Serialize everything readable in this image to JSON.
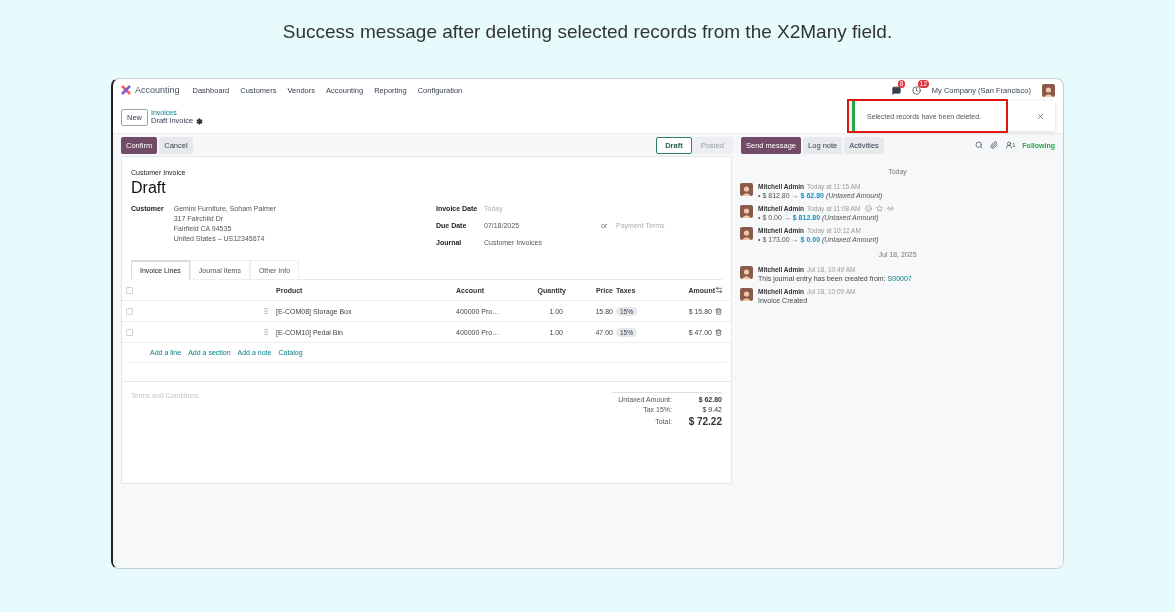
{
  "caption": "Success message after deleting selected records from the X2Many field.",
  "navbar": {
    "app": "Accounting",
    "menu": [
      "Dashboard",
      "Customers",
      "Vendors",
      "Accounting",
      "Reporting",
      "Configuration"
    ],
    "message_count": "8",
    "activity_count": "12",
    "company": "My Company (San Francisco)"
  },
  "breadcrumb": {
    "new_button": "New",
    "parent": "Invoices",
    "current": "Draft Invoice"
  },
  "notification": {
    "message": "Selected records have been deleted."
  },
  "actions": [
    {
      "label": "Confirm",
      "kind": "primary"
    },
    {
      "label": "Cancel",
      "kind": "secondary"
    }
  ],
  "statusbar": [
    {
      "label": "Draft",
      "selected": true
    },
    {
      "label": "Posted",
      "selected": false
    }
  ],
  "chatter_buttons": [
    {
      "label": "Send message",
      "kind": "primary"
    },
    {
      "label": "Log note",
      "kind": "secondary"
    },
    {
      "label": "Activities",
      "kind": "secondary"
    }
  ],
  "followers": {
    "count": "1",
    "following": "Following"
  },
  "form": {
    "type_label": "Customer Invoice",
    "title": "Draft",
    "customer": {
      "label": "Customer",
      "lines": [
        "Gemini Furniture, Soham Palmer",
        "317 Fairchild Dr",
        "Fairfield CA 94535",
        "United States – US12345674"
      ]
    },
    "fields": [
      {
        "label": "Invoice Date",
        "placeholder": "Today"
      },
      {
        "label": "Due Date",
        "value": "07/18/2025",
        "or": "or",
        "terms_placeholder": "Payment Terms"
      },
      {
        "label": "Journal",
        "value": "Customer Invoices"
      }
    ],
    "select_all_checked": false,
    "tabs": [
      {
        "label": "Invoice Lines",
        "selected": true
      },
      {
        "label": "Journal Items",
        "selected": false
      },
      {
        "label": "Other Info",
        "selected": false
      }
    ],
    "columns": [
      "Product",
      "Account",
      "Quantity",
      "Price",
      "Taxes",
      "Amount"
    ],
    "rows": [
      {
        "checked": false,
        "product": "[E-COM08] Storage Box",
        "account": "400000 Pro…",
        "quantity": "1.00",
        "price": "15.80",
        "tax": "15%",
        "amount": "$ 15.80"
      },
      {
        "checked": false,
        "product": "[E-COM10] Pedal Bin",
        "account": "400000 Pro…",
        "quantity": "1.00",
        "price": "47.00",
        "tax": "15%",
        "amount": "$ 47.00"
      }
    ],
    "add_links": [
      "Add a line",
      "Add a section",
      "Add a note",
      "Catalog"
    ],
    "terms_placeholder": "Terms and Conditions",
    "totals": [
      {
        "label": "Untaxed Amount:",
        "value": "$ 62.80",
        "kind": "bold"
      },
      {
        "label": "Tax 15%:",
        "value": "$ 9.42",
        "kind": "normal"
      },
      {
        "label": "Total:",
        "value": "$ 72.22",
        "kind": "grand"
      }
    ]
  },
  "chatter": [
    {
      "kind": "date",
      "label": "Today"
    },
    {
      "kind": "tracking",
      "author": "Mitchell Admin",
      "time": "Today at 11:15 AM",
      "hovered": false,
      "bullet": "•",
      "old": "$ 812.80",
      "arrow": "→",
      "new": "$ 62.80",
      "field": "(Untaxed Amount)"
    },
    {
      "kind": "tracking",
      "author": "Mitchell Admin",
      "time": "Today at 11:08 AM",
      "hovered": true,
      "bullet": "•",
      "old": "$ 0.00",
      "arrow": "→",
      "new": "$ 812.80",
      "field": "(Untaxed Amount)"
    },
    {
      "kind": "tracking",
      "author": "Mitchell Admin",
      "time": "Today at 10:12 AM",
      "hovered": false,
      "bullet": "•",
      "old": "$ 173.00",
      "arrow": "→",
      "new": "$ 0.00",
      "field": "(Untaxed Amount)"
    },
    {
      "kind": "date",
      "label": "Jul 18, 2025"
    },
    {
      "kind": "note",
      "author": "Mitchell Admin",
      "time": "Jul 18, 10:49 AM",
      "hovered": false,
      "body": "This journal entry has been created from:",
      "link": "S00007"
    },
    {
      "kind": "note",
      "author": "Mitchell Admin",
      "time": "Jul 18, 10:09 AM",
      "hovered": false,
      "body": "Invoice Created"
    }
  ]
}
